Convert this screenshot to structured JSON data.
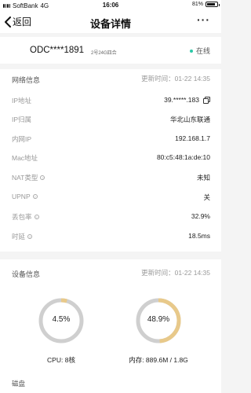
{
  "status_bar": {
    "carrier": "SoftBank",
    "network": "4G",
    "time": "16:06",
    "battery": "81%",
    "battery_level": 0.81
  },
  "nav": {
    "back_label": "返回",
    "title": "设备详情",
    "more": "···"
  },
  "device": {
    "name": "ODC****1891",
    "model": "2号24G四合",
    "status": "在线"
  },
  "network": {
    "title": "网络信息",
    "updated": "更新时间：01-22 14:35",
    "rows": [
      {
        "label": "IP地址",
        "value": "39.*****.183"
      },
      {
        "label": "IP归属",
        "value": "华北山东联通"
      },
      {
        "label": "内网IP",
        "value": "192.168.1.7"
      },
      {
        "label": "Mac地址",
        "value": "80:c5:48:1a:de:10"
      },
      {
        "label": "NAT类型",
        "value": "未知"
      },
      {
        "label": "UPNP",
        "value": "关"
      },
      {
        "label": "丢包率",
        "value": "32.9%"
      },
      {
        "label": "时延",
        "value": "18.5ms"
      }
    ]
  },
  "device_info": {
    "title": "设备信息",
    "updated": "更新时间：01-22 14:35",
    "cpu": {
      "percent_text": "4.5%",
      "percent": 4.5,
      "label": "CPU: 8核"
    },
    "memory": {
      "percent_text": "48.9%",
      "percent": 48.9,
      "label": "内存: 889.6M / 1.8G"
    },
    "disk_title": "磁盘"
  },
  "colors": {
    "accent": "#e8c98a",
    "track": "#cfcfcf",
    "online": "#2bc8a8"
  }
}
